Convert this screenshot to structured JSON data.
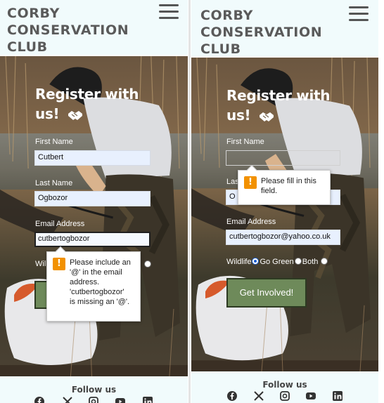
{
  "brand": {
    "line1": "CORBY",
    "line2": "CONSERVATION",
    "line3": "CLUB"
  },
  "form": {
    "title_line1": "Register with",
    "title_line2": "us!",
    "first_name_label": "First Name",
    "last_name_label": "Last Name",
    "email_label": "Email Address",
    "wildlife_label": "Wildlife",
    "go_green_label": "Go Green",
    "both_label": "Both",
    "submit_label": "Get Involved!"
  },
  "left_screen": {
    "first_name_value": "Cutbert",
    "last_name_value": "Ogbozor",
    "email_value": "cutbertogbozor",
    "wildlife_label_visible": "Wil",
    "tooltip_lines": [
      "Please include an",
      "'@' in the email",
      "address.",
      "'cutbertogbozor'",
      "is missing an '@'."
    ]
  },
  "right_screen": {
    "first_name_value": "",
    "last_name_value": "O",
    "last_name_label_visible": "Last",
    "email_value": "cutbertogbozor@yahoo.co.uk",
    "tooltip_lines": [
      "Please fill in this",
      "field."
    ]
  },
  "footer": {
    "follow_label": "Follow us",
    "social_icons": [
      "facebook-icon",
      "x-icon",
      "instagram-icon",
      "youtube-icon",
      "linkedin-icon"
    ]
  },
  "colors": {
    "header_bg": "#f1fbfc",
    "brand_text": "#5a5a5a",
    "button_bg": "#6e8a5a",
    "warning": "#f29100"
  }
}
